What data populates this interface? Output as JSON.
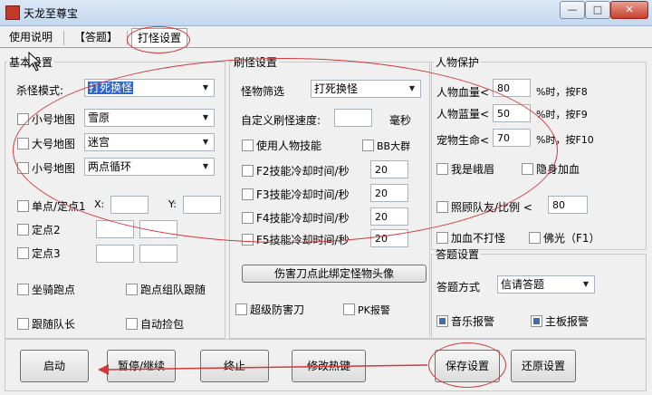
{
  "window": {
    "title": "天龙至尊宝",
    "min": "—",
    "max": "□",
    "close": "✕"
  },
  "tabs": [
    "使用说明",
    "【答题】",
    "打怪设置"
  ],
  "basic": {
    "legend": "基本设置",
    "kill_mode_label": "杀怪模式:",
    "kill_mode_value": "打死换怪",
    "small_map_label": "小号地图",
    "small_map_value": "雪原",
    "big_map_label": "大号地图",
    "big_map_value": "迷宫",
    "small_map2_label": "小号地图",
    "small_map2_value": "两点循环",
    "point1_label": "单点/定点1",
    "x_label": "X:",
    "y_label": "Y:",
    "point2_label": "定点2",
    "point3_label": "定点3",
    "ride_label": "坐骑跑点",
    "group_follow_label": "跑点组队跟随",
    "follow_leader_label": "跟随队长",
    "auto_pick_label": "自动捡包"
  },
  "refresh": {
    "legend": "刷怪设置",
    "filter_label": "怪物筛选",
    "filter_value": "打死换怪",
    "speed_label": "自定义刷怪速度:",
    "speed_unit": "毫秒",
    "use_skill_label": "使用人物技能",
    "bb_group_label": "BB大群",
    "skills": [
      {
        "label": "F2技能冷却时间/秒",
        "value": "20"
      },
      {
        "label": "F3技能冷却时间/秒",
        "value": "20"
      },
      {
        "label": "F4技能冷却时间/秒",
        "value": "20"
      },
      {
        "label": "F5技能冷却时间/秒",
        "value": "20"
      }
    ],
    "bind_button": "伤害刀点此绑定怪物头像",
    "super_blade_label": "超级防害刀",
    "pk_alarm_label": "PK报警"
  },
  "protect": {
    "legend": "人物保护",
    "hp_label": "人物血量<",
    "hp_value": "80",
    "hp_suffix": "%时，按F8",
    "mp_label": "人物蓝量<",
    "mp_value": "50",
    "mp_suffix": "%时，按F9",
    "pet_label": "宠物生命<",
    "pet_value": "70",
    "pet_suffix": "%时，按F10",
    "emei_label": "我是峨眉",
    "stealth_label": "隐身加血",
    "care_label": "照顾队友/比例 <",
    "care_value": "80",
    "heal_only_label": "加血不打怪",
    "buddha_label": "佛光（F1）"
  },
  "answer": {
    "legend": "答题设置",
    "mode_label": "答题方式",
    "mode_value": "信请答题",
    "music_label": "音乐报警",
    "board_label": "主板报警"
  },
  "buttons": [
    "启动",
    "暂停/继续",
    "终止",
    "修改热键",
    "保存设置",
    "还原设置"
  ],
  "colors": {
    "annotation": "#d23a3a",
    "selection": "#3366cc"
  }
}
